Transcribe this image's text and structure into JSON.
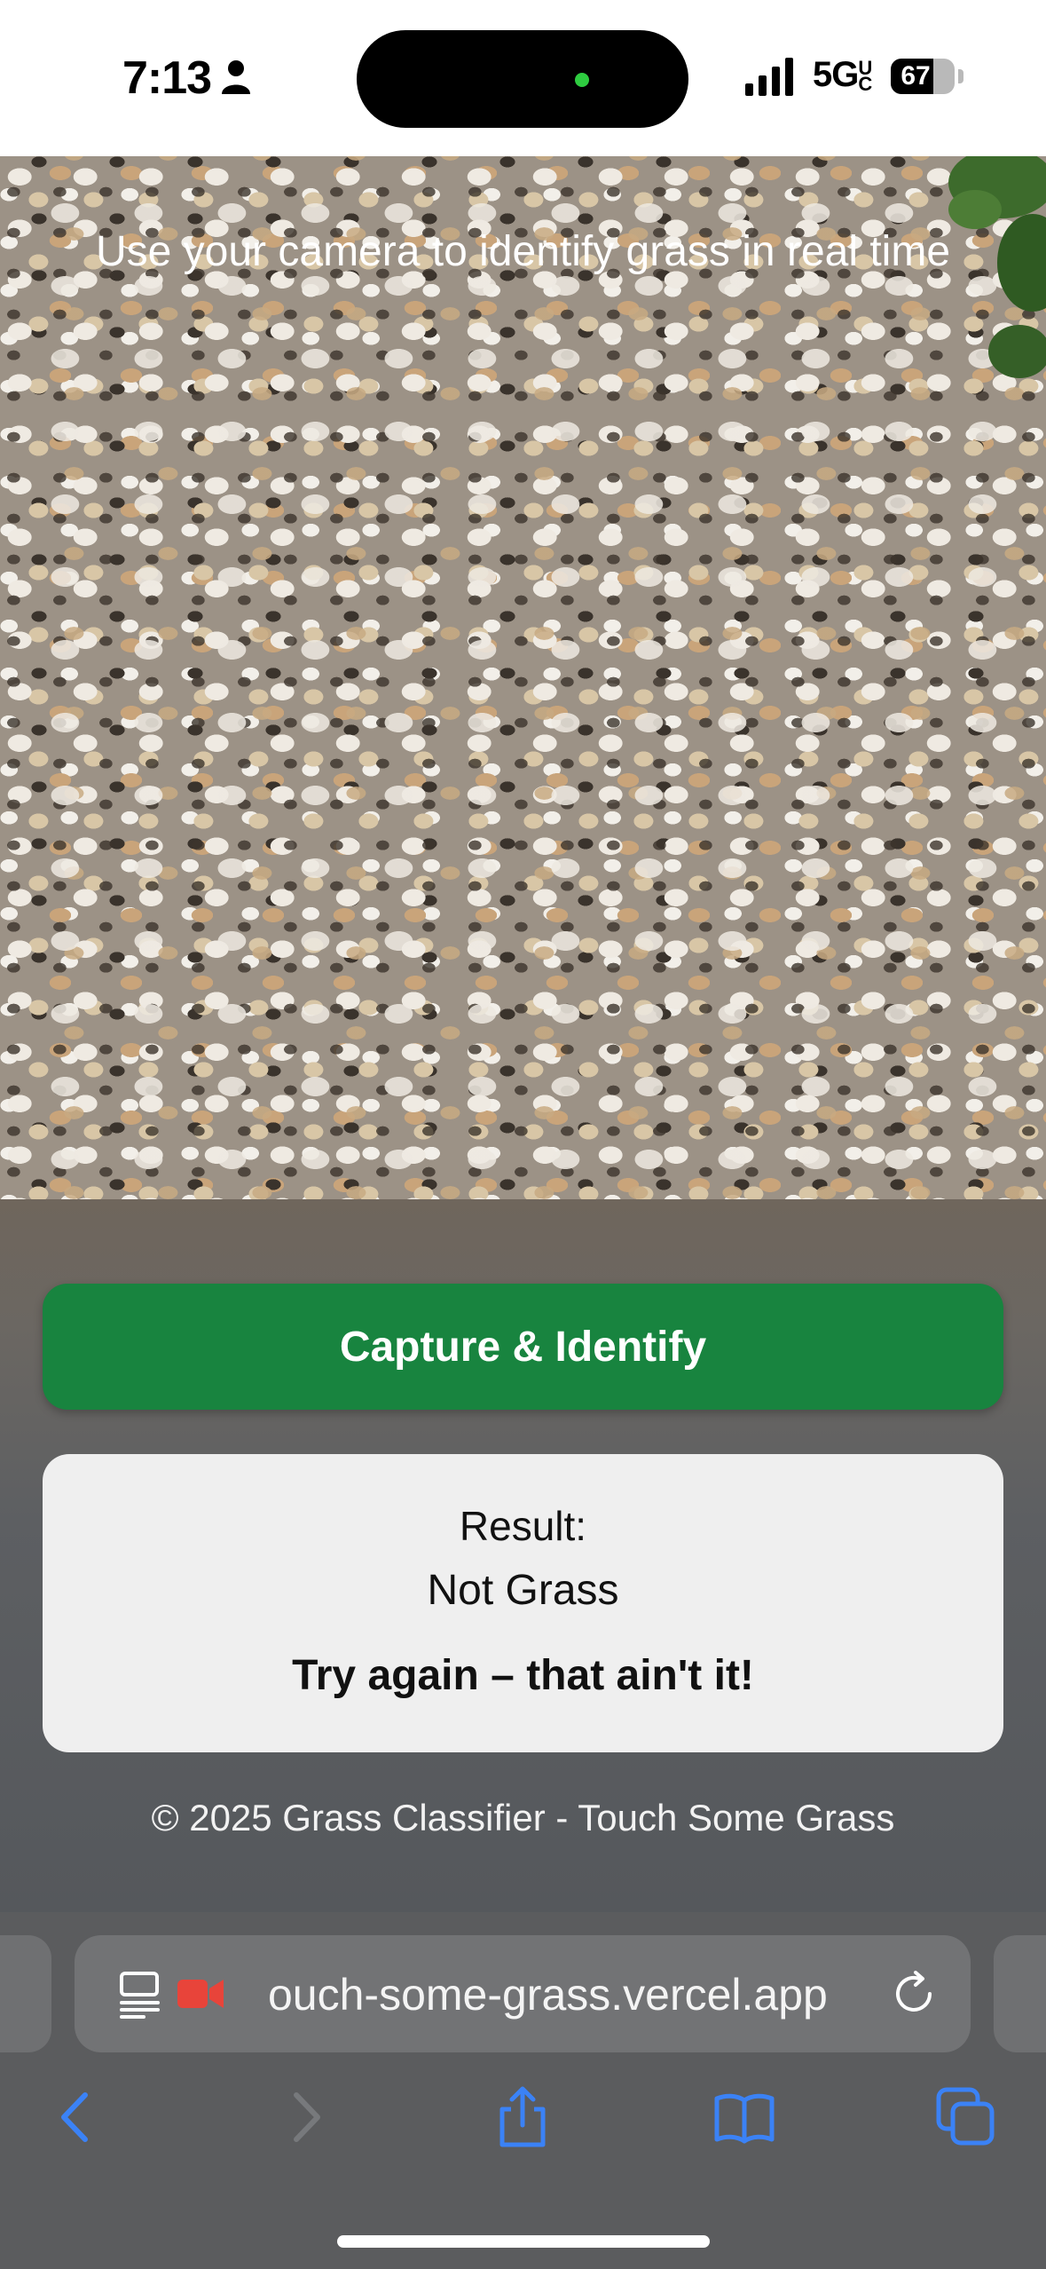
{
  "status_bar": {
    "time": "7:13",
    "network": "5G",
    "network_sub": "UC",
    "battery": "67",
    "battery_level": 0.67,
    "icons": [
      "person-icon",
      "signal-icon",
      "battery-icon"
    ]
  },
  "camera": {
    "hint": "Use your camera to identify grass in real time"
  },
  "actions": {
    "capture_label": "Capture & Identify"
  },
  "result": {
    "label": "Result:",
    "value": "Not Grass",
    "message": "Try again – that ain't it!"
  },
  "footer": {
    "text": "© 2025 Grass Classifier - Touch Some Grass"
  },
  "browser": {
    "url": "ouch-some-grass.vercel.app",
    "icons": [
      "reader-icon",
      "camera-recording-icon",
      "reload-icon",
      "back-icon",
      "forward-icon",
      "share-icon",
      "bookmarks-icon",
      "tabs-icon"
    ]
  },
  "colors": {
    "accent": "#18843f",
    "link_blue": "#3b82f6",
    "recording_red": "#e8443a"
  }
}
